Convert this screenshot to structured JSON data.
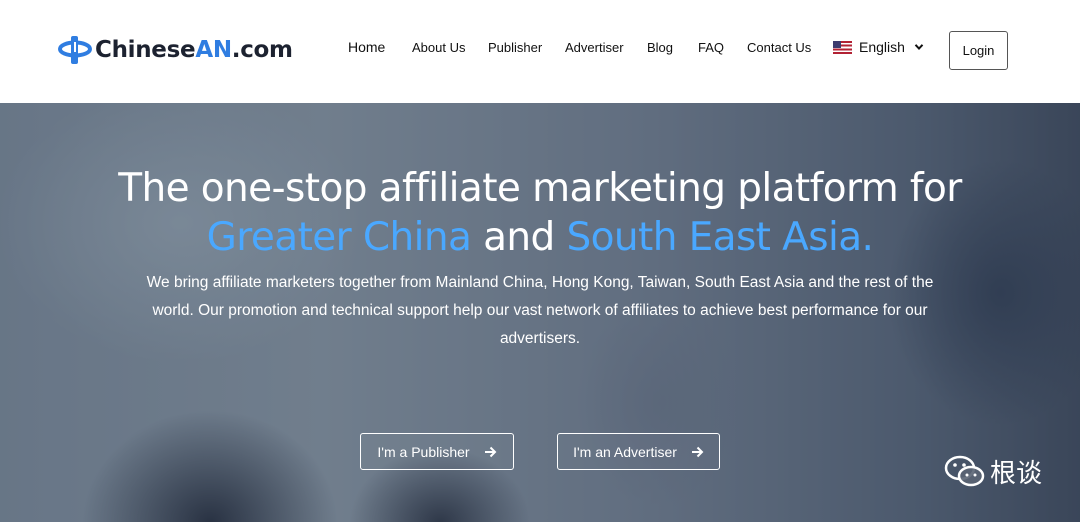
{
  "header": {
    "logo": {
      "prefix": "Chinese",
      "accent": "AN",
      "suffix": ".com"
    },
    "nav": [
      {
        "label": "Home"
      },
      {
        "label": "About Us"
      },
      {
        "label": "Publisher"
      },
      {
        "label": "Advertiser"
      },
      {
        "label": "Blog"
      },
      {
        "label": "FAQ"
      },
      {
        "label": "Contact Us"
      }
    ],
    "language": {
      "label": "English",
      "icon": "us-flag-icon"
    },
    "login_label": "Login"
  },
  "hero": {
    "line1": "The one-stop affiliate marketing platform for",
    "line2": {
      "highlight1": "Greater China",
      "connector": " and ",
      "highlight2": "South East Asia",
      "end": "."
    },
    "subtext": "We bring affiliate marketers together from Mainland China, Hong Kong, Taiwan, South East Asia and the rest of the world. Our promotion and technical support help our vast network of affiliates to achieve best performance for our advertisers.",
    "cta_publisher": "I'm a Publisher",
    "cta_advertiser": "I'm an Advertiser"
  },
  "watermark": {
    "text": "根谈",
    "icon": "wechat-icon"
  },
  "colors": {
    "accent": "#2f7de1",
    "highlight": "#4aa8ff",
    "text": "#111111"
  }
}
